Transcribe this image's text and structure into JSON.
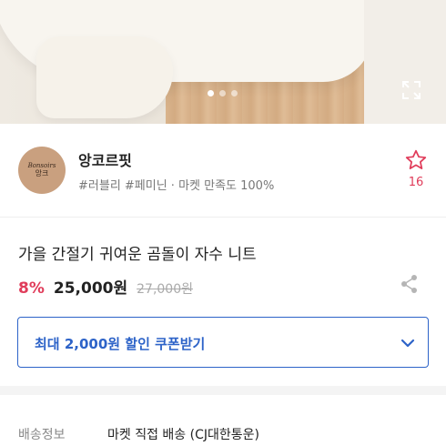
{
  "carousel": {
    "slide_count": 3,
    "active_index": 0,
    "colors": {
      "active_dot": "#ffffff",
      "inactive_dot": "rgba(255,255,255,0.55)"
    },
    "expand_icon": "expand-icon"
  },
  "shop": {
    "logo_line1": "Bonsoirs",
    "logo_line2": "앙크",
    "name": "앙코르핏",
    "tags": "#러블리 #페미닌 · 마켓 만족도 100%",
    "like_icon": "star-outline-icon",
    "like_count": "16"
  },
  "product": {
    "title": "가을 간절기 귀여운 곰돌이 자수 니트",
    "discount": "8%",
    "price": "25,000원",
    "original_price": "27,000원",
    "share_icon": "share-icon"
  },
  "coupon": {
    "label": "최대 2,000원 할인 쿠폰받기",
    "chevron_icon": "chevron-down-icon"
  },
  "shipping": {
    "label": "배송정보",
    "value": "마켓 직접 배송 (CJ대한통운)"
  },
  "colors": {
    "accent_blue": "#2d63c8",
    "accent_red": "#e03c5a",
    "text": "#222222",
    "muted": "#888888"
  }
}
